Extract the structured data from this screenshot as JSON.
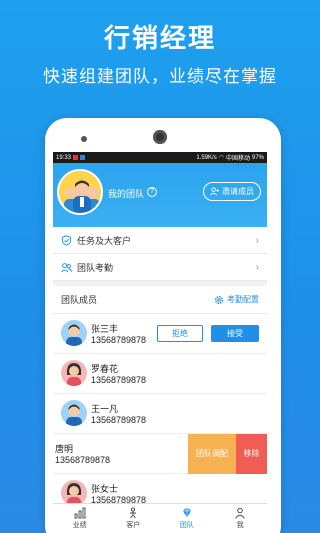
{
  "promo": {
    "title": "行销经理",
    "subtitle": "快速组建团队，业绩尽在掌握"
  },
  "statusbar": {
    "time": "19:33",
    "speed": "1.59K/s",
    "carrier": "中国移动",
    "battery": "97%"
  },
  "team_header": {
    "label": "我的团队",
    "help": "?",
    "invite_label": "邀请成员"
  },
  "menu": [
    {
      "label": "任务及大客户",
      "icon": "shield-check-icon"
    },
    {
      "label": "团队考勤",
      "icon": "team-attendance-icon"
    }
  ],
  "members_section": {
    "title": "团队成员",
    "config_label": "考勤配置"
  },
  "members": [
    {
      "name": "张三丰",
      "phone": "13568789878",
      "avatar": "male-avatar"
    },
    {
      "name": "罗春花",
      "phone": "13568789878",
      "avatar": "female-avatar"
    },
    {
      "name": "王一凡",
      "phone": "13568789878",
      "avatar": "male-avatar"
    },
    {
      "name": "唐明",
      "phone": "13568789878",
      "avatar": "male-avatar"
    },
    {
      "name": "张女士",
      "phone": "13568789878",
      "avatar": "female-avatar"
    }
  ],
  "actions": {
    "reject": "拒绝",
    "accept": "接受",
    "adjust_team": "团队调配",
    "remove": "移除"
  },
  "tabs": [
    {
      "label": "业绩",
      "icon": "bar-chart-icon"
    },
    {
      "label": "客户",
      "icon": "customer-icon"
    },
    {
      "label": "团队",
      "icon": "diamond-icon",
      "active": true
    },
    {
      "label": "我",
      "icon": "person-icon"
    }
  ],
  "colors": {
    "brand_blue": "#1f8fe9",
    "adjust_orange": "#f5b152",
    "remove_red": "#ef5d55"
  }
}
